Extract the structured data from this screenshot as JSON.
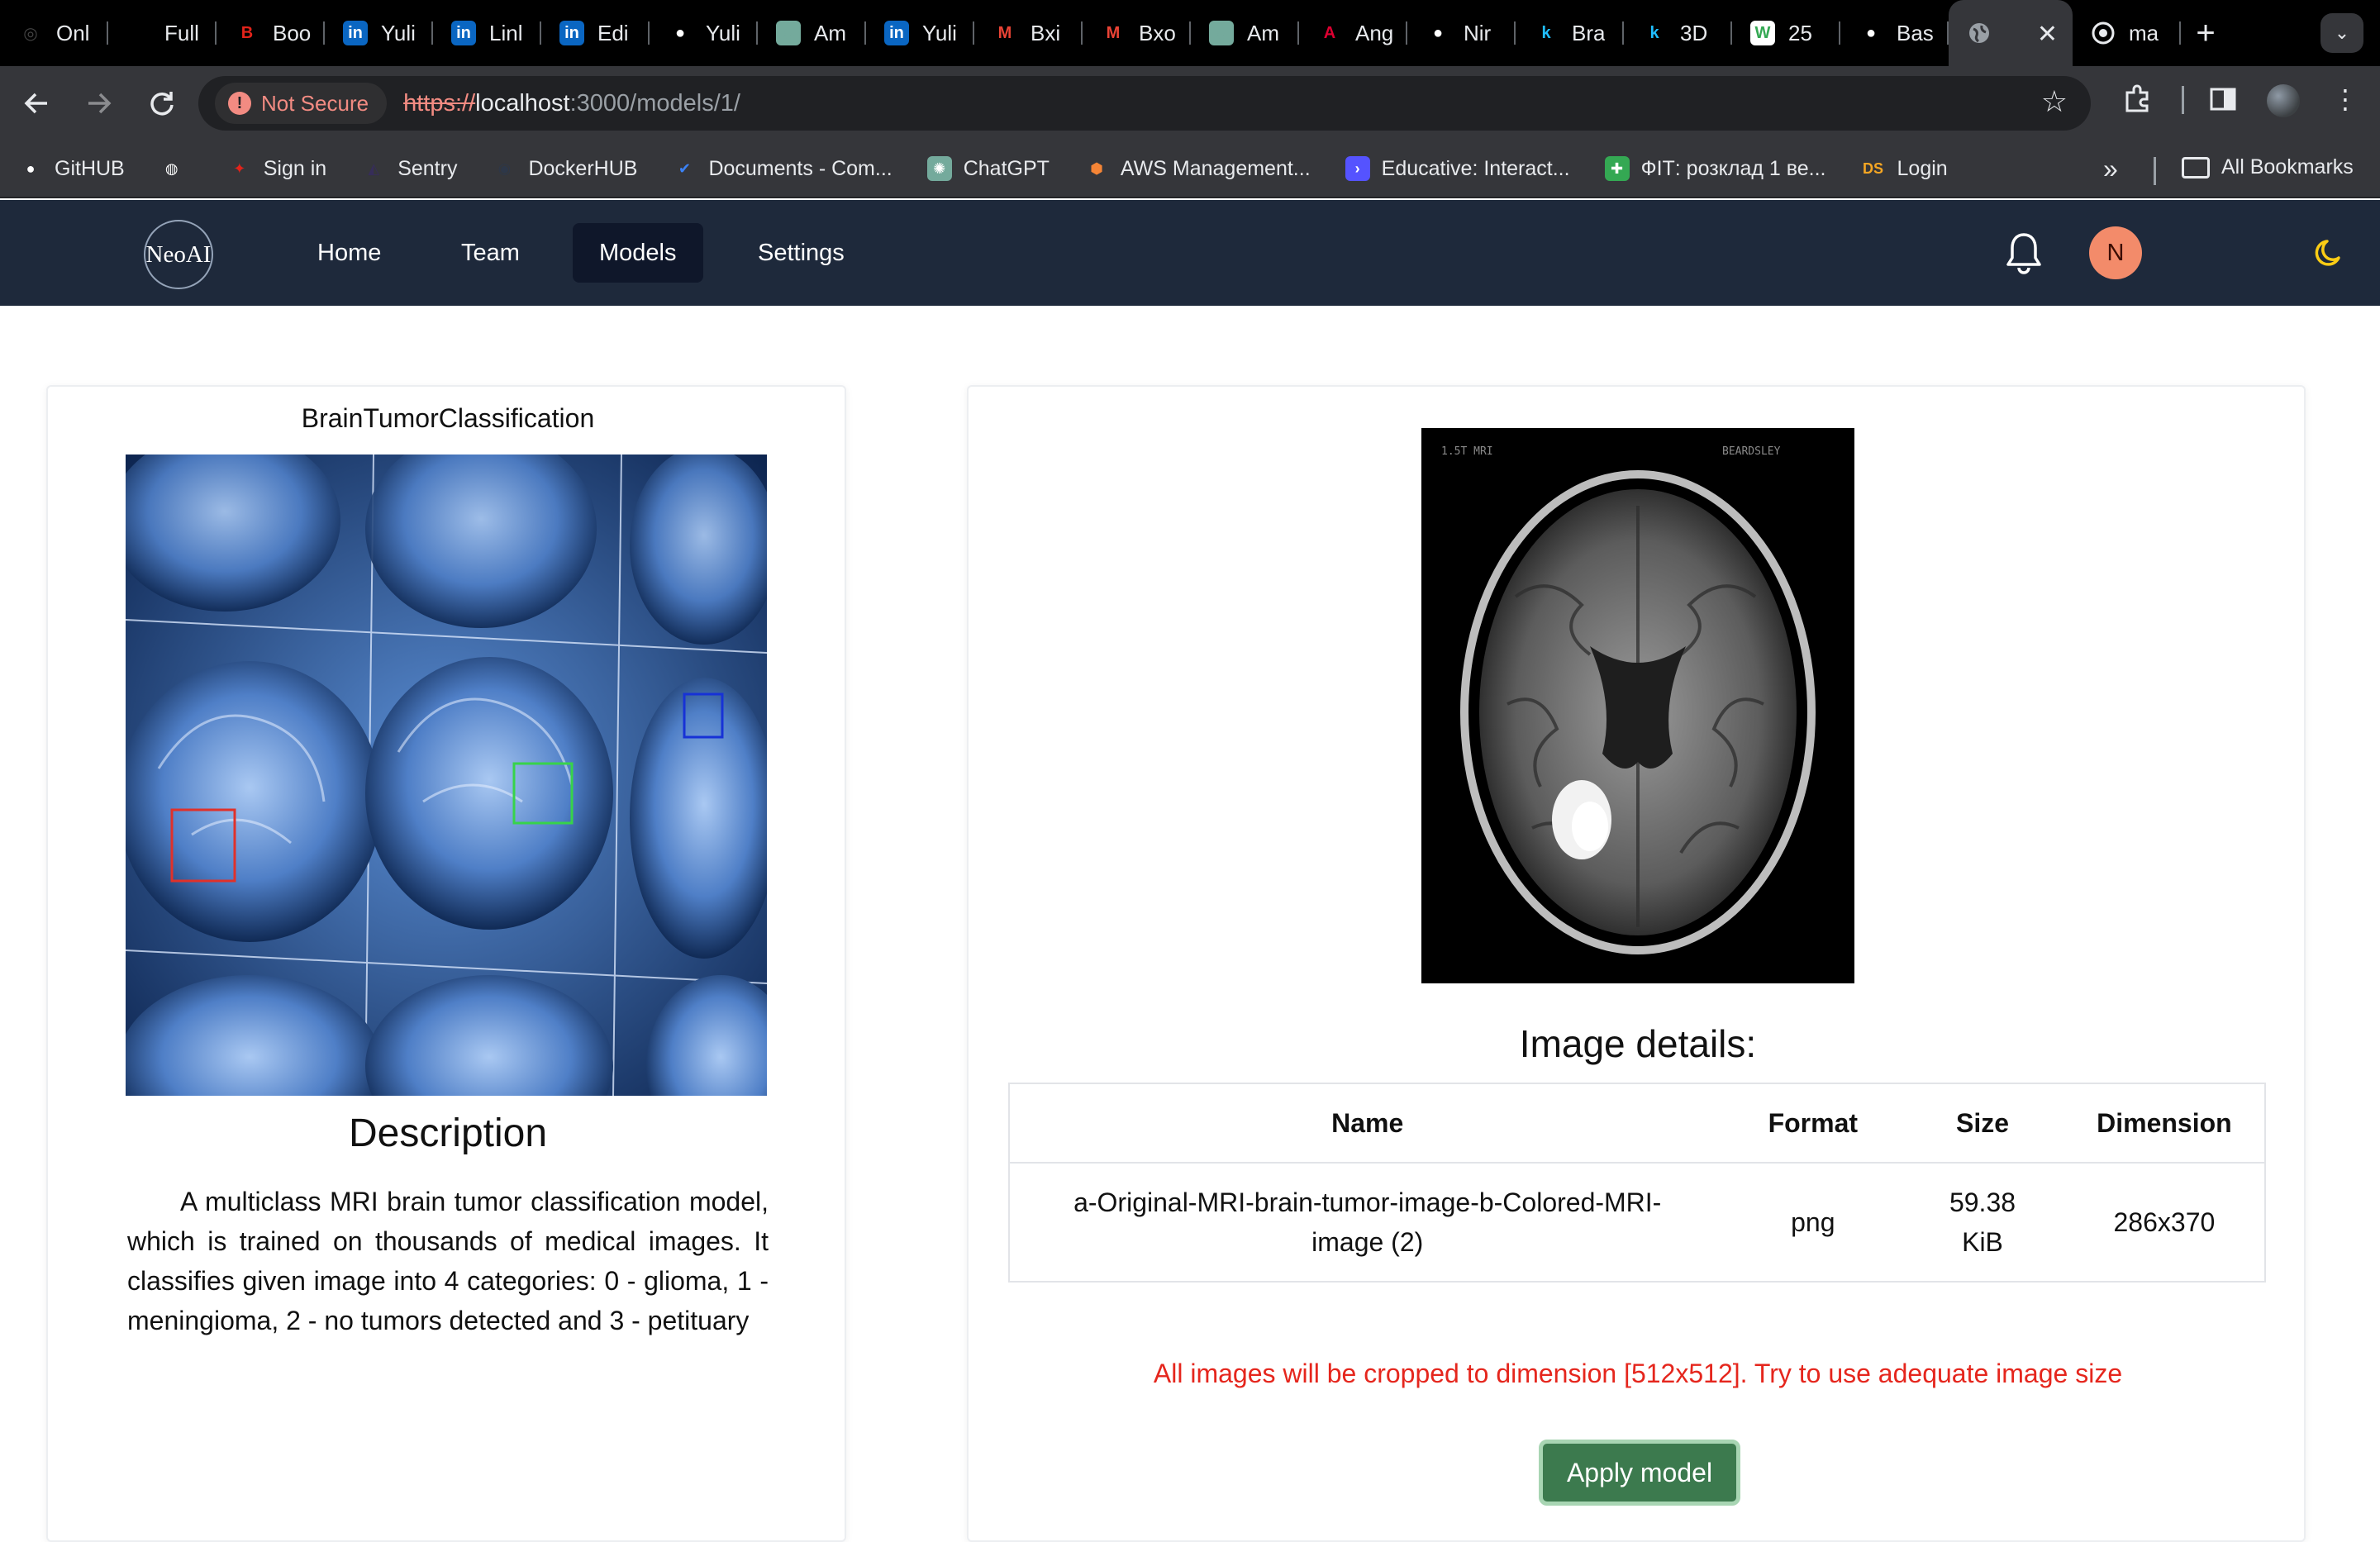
{
  "browser": {
    "tabs": [
      {
        "label": "Onl",
        "icon": "openai-icon",
        "color": "#444444"
      },
      {
        "label": "Full",
        "icon": "blank-icon",
        "color": "#000000"
      },
      {
        "label": "Boo",
        "icon": "bc-icon",
        "color": "#e2231a"
      },
      {
        "label": "Yuli",
        "icon": "linkedin-icon",
        "color": "#0a66c2"
      },
      {
        "label": "Linl",
        "icon": "linkedin-icon",
        "color": "#0a66c2"
      },
      {
        "label": "Edi",
        "icon": "linkedin-icon",
        "color": "#0a66c2"
      },
      {
        "label": "Yuli",
        "icon": "github-icon",
        "color": "#ffffff"
      },
      {
        "label": "Am",
        "icon": "chatgpt-icon",
        "color": "#74aa9c"
      },
      {
        "label": "Yuli",
        "icon": "linkedin-icon",
        "color": "#0a66c2"
      },
      {
        "label": "Bxi",
        "icon": "gmail-icon",
        "color": "#ea4335"
      },
      {
        "label": "Bxo",
        "icon": "gmail-icon",
        "color": "#ea4335"
      },
      {
        "label": "Am",
        "icon": "chatgpt-icon",
        "color": "#74aa9c"
      },
      {
        "label": "Ang",
        "icon": "angular-icon",
        "color": "#dd0031"
      },
      {
        "label": "Nir",
        "icon": "github-icon",
        "color": "#ffffff"
      },
      {
        "label": "Bra",
        "icon": "kaggle-icon",
        "color": "#20beff"
      },
      {
        "label": "3D",
        "icon": "kaggle-icon",
        "color": "#20beff"
      },
      {
        "label": "25",
        "icon": "sheet-icon",
        "color": "#ffffff"
      },
      {
        "label": "Bas",
        "icon": "github-icon",
        "color": "#ffffff"
      }
    ],
    "active_tab": {
      "label": "",
      "icon": "globe-icon"
    },
    "last_tab": {
      "label": "ma",
      "icon": "globe-icon"
    },
    "security_chip": "Not Secure",
    "url_scheme": "https://",
    "url_host": "localhost",
    "url_rest": ":3000/models/1/",
    "bookmarks": [
      {
        "label": "GitHUB",
        "icon": "github-icon",
        "color": "#ffffff"
      },
      {
        "label": "",
        "icon": "globe-icon",
        "color": "#ffffff"
      },
      {
        "label": "Sign in",
        "icon": "maple-leaf-icon",
        "color": "#e2231a"
      },
      {
        "label": "Sentry",
        "icon": "sentry-icon",
        "color": "#362d59"
      },
      {
        "label": "DockerHUB",
        "icon": "docker-icon",
        "color": "#2d3748"
      },
      {
        "label": "Documents - Com...",
        "icon": "checkmark-icon",
        "color": "#3b82f6"
      },
      {
        "label": "ChatGPT",
        "icon": "chatgpt-icon",
        "color": "#74aa9c"
      },
      {
        "label": "AWS Management...",
        "icon": "aws-icon",
        "color": "#f58536"
      },
      {
        "label": "Educative: Interact...",
        "icon": "educative-icon",
        "color": "#5553ff"
      },
      {
        "label": "ФІТ: розклад 1 ве...",
        "icon": "plus-sheet-icon",
        "color": "#34a853"
      },
      {
        "label": "Login",
        "icon": "ds-icon",
        "color": "#f5a623"
      }
    ],
    "all_bookmarks": "All Bookmarks"
  },
  "app": {
    "logo": "NeoAI",
    "nav": [
      {
        "label": "Home",
        "active": false
      },
      {
        "label": "Team",
        "active": false
      },
      {
        "label": "Models",
        "active": true
      },
      {
        "label": "Settings",
        "active": false
      }
    ],
    "avatar_initial": "N"
  },
  "model": {
    "title": "BrainTumorClassification",
    "description_heading": "Description",
    "description": "A multiclass MRI brain tumor classification model, which is trained on thousands of medical images. It classifies given image into 4 categories: 0 - glioma, 1 - meningioma, 2 - no tumors detected and 3 - petituary"
  },
  "image_details": {
    "heading": "Image details:",
    "columns": [
      "Name",
      "Format",
      "Size",
      "Dimension"
    ],
    "row": {
      "name": "a-Original-MRI-brain-tumor-image-b-Colored-MRI-image (2)",
      "format": "png",
      "size": "59.38 KiB",
      "dimension": "286x370"
    }
  },
  "warning": "All images will be cropped to dimension [512x512]. Try to use adequate image size",
  "apply_button": "Apply model",
  "colors": {
    "nav_bg": "#1e293b",
    "nav_active": "#0f172a",
    "avatar": "#f38b6a",
    "warning": "#e5261d",
    "button": "#3c7a4e",
    "chrome_bg": "#35363a"
  }
}
